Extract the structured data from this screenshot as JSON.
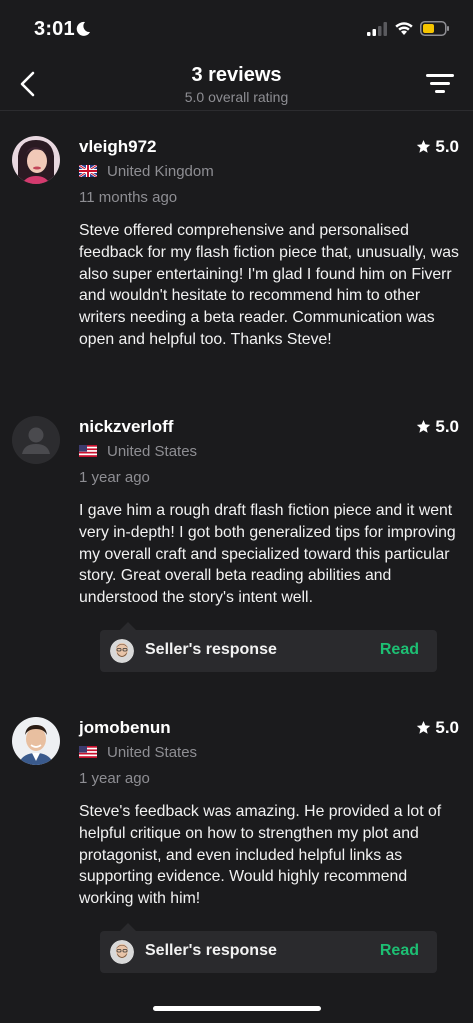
{
  "status": {
    "time": "3:01"
  },
  "nav": {
    "title": "3 reviews",
    "subtitle": "5.0 overall rating"
  },
  "reviews": [
    {
      "username": "vleigh972",
      "rating": "5.0",
      "country": "United Kingdom",
      "ago": "11 months ago",
      "text": "Steve offered comprehensive and personalised feedback for my flash fiction piece that, unusually, was also super entertaining! I'm glad I found him on Fiverr and wouldn't hesitate to recommend him to other writers needing a beta reader. Communication was open and helpful too. Thanks Steve!"
    },
    {
      "username": "nickzverloff",
      "rating": "5.0",
      "country": "United States",
      "ago": "1 year ago",
      "text": "I gave him a rough draft flash fiction piece and it went very in-depth! I got both generalized tips for improving my overall craft and specialized toward this particular story. Great overall beta reading abilities and understood the story's intent well.",
      "response_label": "Seller's response",
      "response_action": "Read"
    },
    {
      "username": "jomobenun",
      "rating": "5.0",
      "country": "United States",
      "ago": "1 year ago",
      "text": "Steve's feedback was amazing. He provided a lot of helpful critique on how to strengthen my plot and protagonist, and even included helpful links as supporting evidence. Would highly recommend working with him!",
      "response_label": "Seller's response",
      "response_action": "Read"
    }
  ],
  "colors": {
    "background": "#1b1b1d",
    "accent_green": "#1dbf73",
    "muted": "#8e8e93",
    "battery": "#f5c400"
  }
}
